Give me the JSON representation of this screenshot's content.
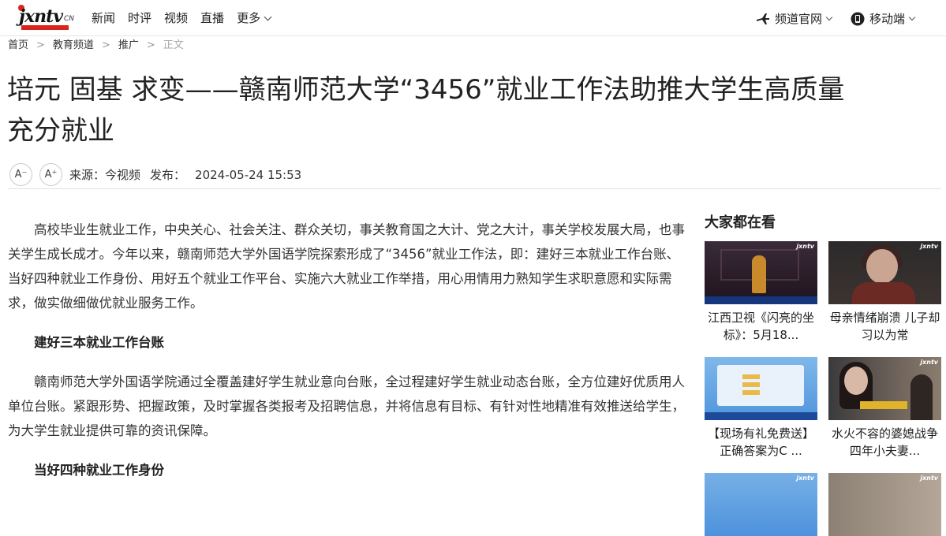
{
  "header": {
    "logo_text": "jxntv",
    "logo_suffix": "CN",
    "nav": [
      "新闻",
      "时评",
      "视频",
      "直播",
      "更多"
    ],
    "right": [
      {
        "icon": "plane-icon",
        "label": "频道官网"
      },
      {
        "icon": "phone-icon",
        "label": "移动端"
      }
    ]
  },
  "breadcrumb": {
    "items": [
      "首页",
      "教育频道",
      "推广"
    ],
    "current": "正文",
    "separator": ">"
  },
  "article": {
    "title_line1": "培元 固基 求变——赣南师范大学“3456”就业工作法助推大学生高质量",
    "title_line2": "充分就业",
    "font_decrease": "A⁻",
    "font_increase": "A⁺",
    "source": "来源：今视频",
    "published_label": "发布：",
    "published_time": "2024-05-24 15:53",
    "paragraph1": "高校毕业生就业工作，中央关心、社会关注、群众关切，事关教育国之大计、党之大计，事关学校发展大局，也事关学生成长成才。今年以来，赣南师范大学外国语学院探索形成了“3456”就业工作法，即：建好三本就业工作台账、当好四种就业工作身份、用好五个就业工作平台、实施六大就业工作举措，用心用情用力熟知学生求职意愿和实际需求，做实做细做优就业服务工作。",
    "heading1": "建好三本就业工作台账",
    "paragraph2": "赣南师范大学外国语学院通过全覆盖建好学生就业意向台账，全过程建好学生就业动态台账，全方位建好优质用人单位台账。紧跟形势、把握政策，及时掌握各类报考及招聘信息，并将信息有目标、有针对性地精准有效推送给学生，为大学生就业提供可靠的资讯保障。",
    "heading2": "当好四种就业工作身份"
  },
  "sidebar": {
    "title": "大家都在看",
    "cards": [
      {
        "caption": "江西卫视《闪亮的坐标》：5月18..."
      },
      {
        "caption": "母亲情绪崩溃 儿子却习以为常"
      },
      {
        "caption": "【现场有礼免费送】正确答案为C ..."
      },
      {
        "caption": "水火不容的婆媳战争 四年小夫妻..."
      },
      {
        "caption": ""
      },
      {
        "caption": ""
      }
    ],
    "watermark": "jxntv"
  },
  "colors": {
    "brand_red": "#d9231d",
    "text": "#222222",
    "muted": "#aaaaaa"
  }
}
